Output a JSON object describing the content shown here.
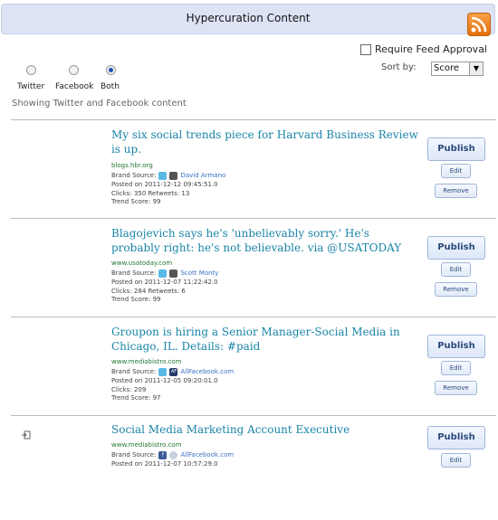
{
  "header": {
    "title": "Hypercuration Content",
    "rss_icon": "rss-icon"
  },
  "controls": {
    "require_feed_approval": "Require Feed Approval",
    "sort_by_label": "Sort by:",
    "sort_value": "Score",
    "radios": [
      "Twitter",
      "Facebook",
      "Both"
    ],
    "selected": "Both",
    "showing": "Showing Twitter and Facebook content"
  },
  "labels": {
    "brand_source": "Brand Source:",
    "publish": "Publish",
    "edit": "Edit",
    "remove": "Remove"
  },
  "items": [
    {
      "title": "My six social trends piece for Harvard Business Review is up.",
      "source": "blogs.hbr.org",
      "brand": "David Armano",
      "posted": "Posted on 2011-12-12 09:45:51.0",
      "stats": "Clicks: 350 Retweets: 13",
      "trend": "Trend Score: 99"
    },
    {
      "title": "Blagojevich says he's 'unbelievably sorry.' He's probably right: he's not believable. via @USATODAY",
      "source": "www.usatoday.com",
      "brand": "Scott Monty",
      "posted": "Posted on 2011-12-07 11:22:42.0",
      "stats": "Clicks: 284 Retweets: 6",
      "trend": "Trend Score: 99"
    },
    {
      "title": "Groupon is hiring a Senior Manager-Social Media in Chicago, IL. Details: #paid",
      "source": "www.mediabistro.com",
      "brand": "AllFacebook.com",
      "posted": "Posted on 2011-12-05 09:20:01.0",
      "stats": "Clicks: 209",
      "trend": "Trend Score: 97"
    },
    {
      "title": "Social Media Marketing Account Executive",
      "source": "www.mediabistro.com",
      "brand": "AllFacebook.com",
      "posted": "Posted on 2011-12-07 10:57:29.0"
    }
  ]
}
